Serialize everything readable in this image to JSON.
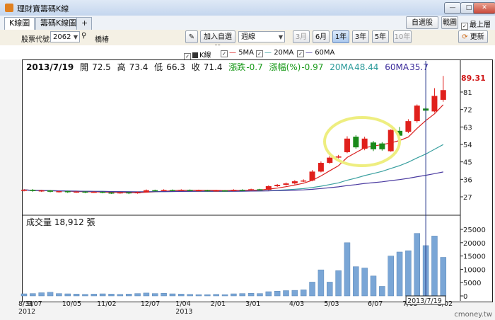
{
  "window": {
    "title": "理財寶籌碼K線",
    "toolbar_buttons": {
      "watchlist": "自選股",
      "print": "戰圖",
      "topmost": "最上層",
      "refresh": "更新"
    },
    "topmost_checked": true
  },
  "tabs": [
    {
      "label": "K線圖",
      "active": true
    },
    {
      "label": "籌碼K線圖",
      "active": false
    }
  ],
  "toolbar": {
    "stock_code_label": "股票代號:",
    "stock_code": "2062",
    "stock_name": "橋椿",
    "add_watchlist": "加入自選股",
    "period": "週線",
    "ranges": [
      {
        "label": "3月",
        "state": "disabled"
      },
      {
        "label": "6月",
        "state": "normal"
      },
      {
        "label": "1年",
        "state": "active"
      },
      {
        "label": "3年",
        "state": "normal"
      },
      {
        "label": "5年",
        "state": "normal"
      },
      {
        "label": "10年",
        "state": "disabled"
      }
    ]
  },
  "legend": [
    {
      "label": "K線",
      "color": "#222222"
    },
    {
      "label": "5MA",
      "color": "#d92020"
    },
    {
      "label": "20MA",
      "color": "#3aa0a0"
    },
    {
      "label": "60MA",
      "color": "#4a3aa0"
    }
  ],
  "info": {
    "date": "2013/7/19",
    "open_label": "開",
    "open": "72.5",
    "high_label": "高",
    "high": "73.4",
    "low_label": "低",
    "low": "66.3",
    "close_label": "收",
    "close": "71.4",
    "change_label": "漲跌",
    "change": "-0.7",
    "change_pct_label": "漲幅(%)",
    "change_pct": "-0.97",
    "ma20_label": "20MA",
    "ma20": "48.44",
    "ma60_label": "60MA",
    "ma60": "35.7"
  },
  "volume_label": "成交量 18,912 張",
  "crosshair_date": "2013/7/19",
  "watermark": "cmoney.tw",
  "chart_data": {
    "type": "candlestick",
    "max_marker": "89.31",
    "price_ticks": [
      81,
      72,
      63,
      54,
      45,
      36,
      27
    ],
    "volume_ticks": [
      25000,
      20000,
      15000,
      10000,
      5000,
      0
    ],
    "x_ticks": [
      {
        "label": "8/31",
        "sub": "2012",
        "i": 0
      },
      {
        "label": "9/07",
        "i": 1
      },
      {
        "label": "10/05",
        "i": 5
      },
      {
        "label": "11/02",
        "i": 9
      },
      {
        "label": "12/07",
        "i": 14
      },
      {
        "label": "1/04",
        "sub": "2013",
        "i": 18
      },
      {
        "label": "2/01",
        "i": 22
      },
      {
        "label": "3/01",
        "i": 26
      },
      {
        "label": "4/03",
        "i": 31
      },
      {
        "label": "5/03",
        "i": 35
      },
      {
        "label": "6/07",
        "i": 40
      },
      {
        "label": "7/05",
        "i": 44
      },
      {
        "label": "8/02",
        "i": 48
      }
    ],
    "candles": [
      {
        "o": 30.2,
        "c": 30.6,
        "h": 31.0,
        "l": 29.8,
        "v": 800
      },
      {
        "o": 30.6,
        "c": 30.0,
        "h": 31.0,
        "l": 29.6,
        "v": 900
      },
      {
        "o": 30.0,
        "c": 30.3,
        "h": 30.6,
        "l": 29.5,
        "v": 1200
      },
      {
        "o": 30.3,
        "c": 29.6,
        "h": 30.5,
        "l": 29.3,
        "v": 1400
      },
      {
        "o": 29.6,
        "c": 29.9,
        "h": 30.2,
        "l": 29.2,
        "v": 900
      },
      {
        "o": 29.9,
        "c": 29.4,
        "h": 30.1,
        "l": 29.0,
        "v": 800
      },
      {
        "o": 29.4,
        "c": 29.7,
        "h": 30.0,
        "l": 29.1,
        "v": 700
      },
      {
        "o": 29.7,
        "c": 29.3,
        "h": 29.9,
        "l": 28.9,
        "v": 600
      },
      {
        "o": 29.3,
        "c": 29.6,
        "h": 29.9,
        "l": 29.0,
        "v": 700
      },
      {
        "o": 29.6,
        "c": 29.2,
        "h": 29.8,
        "l": 28.8,
        "v": 800
      },
      {
        "o": 29.2,
        "c": 28.9,
        "h": 29.5,
        "l": 28.5,
        "v": 700
      },
      {
        "o": 28.9,
        "c": 29.3,
        "h": 29.6,
        "l": 28.6,
        "v": 600
      },
      {
        "o": 29.3,
        "c": 28.8,
        "h": 29.5,
        "l": 28.4,
        "v": 700
      },
      {
        "o": 28.8,
        "c": 29.4,
        "h": 29.7,
        "l": 28.6,
        "v": 900
      },
      {
        "o": 29.4,
        "c": 30.4,
        "h": 30.8,
        "l": 29.2,
        "v": 1100
      },
      {
        "o": 30.4,
        "c": 30.1,
        "h": 30.7,
        "l": 29.8,
        "v": 900
      },
      {
        "o": 30.1,
        "c": 30.5,
        "h": 30.9,
        "l": 29.9,
        "v": 1000
      },
      {
        "o": 30.5,
        "c": 30.3,
        "h": 30.8,
        "l": 30.0,
        "v": 800
      },
      {
        "o": 30.3,
        "c": 30.6,
        "h": 30.9,
        "l": 30.0,
        "v": 700
      },
      {
        "o": 30.6,
        "c": 30.2,
        "h": 30.8,
        "l": 29.9,
        "v": 600
      },
      {
        "o": 30.2,
        "c": 30.4,
        "h": 30.7,
        "l": 29.9,
        "v": 500
      },
      {
        "o": 30.4,
        "c": 30.1,
        "h": 30.6,
        "l": 29.8,
        "v": 500
      },
      {
        "o": 30.1,
        "c": 30.3,
        "h": 30.6,
        "l": 29.9,
        "v": 600
      },
      {
        "o": 30.3,
        "c": 30.0,
        "h": 30.5,
        "l": 29.8,
        "v": 500
      },
      {
        "o": 30.0,
        "c": 30.6,
        "h": 30.9,
        "l": 29.8,
        "v": 800
      },
      {
        "o": 30.6,
        "c": 30.3,
        "h": 30.9,
        "l": 30.0,
        "v": 900
      },
      {
        "o": 30.3,
        "c": 30.9,
        "h": 31.2,
        "l": 30.1,
        "v": 1000
      },
      {
        "o": 30.9,
        "c": 30.6,
        "h": 31.1,
        "l": 30.3,
        "v": 900
      },
      {
        "o": 30.6,
        "c": 32.5,
        "h": 32.9,
        "l": 30.4,
        "v": 1600
      },
      {
        "o": 32.5,
        "c": 33.2,
        "h": 33.6,
        "l": 32.1,
        "v": 1800
      },
      {
        "o": 33.2,
        "c": 33.9,
        "h": 34.4,
        "l": 32.8,
        "v": 2000
      },
      {
        "o": 33.9,
        "c": 35.0,
        "h": 35.6,
        "l": 33.4,
        "v": 2100
      },
      {
        "o": 35.0,
        "c": 35.4,
        "h": 36.0,
        "l": 34.6,
        "v": 2300
      },
      {
        "o": 35.4,
        "c": 40.0,
        "h": 40.8,
        "l": 35.0,
        "v": 5200
      },
      {
        "o": 40.0,
        "c": 44.5,
        "h": 45.2,
        "l": 39.6,
        "v": 9800
      },
      {
        "o": 44.5,
        "c": 47.2,
        "h": 48.0,
        "l": 44.0,
        "v": 5200
      },
      {
        "o": 47.2,
        "c": 47.8,
        "h": 48.6,
        "l": 46.8,
        "v": 9500
      },
      {
        "o": 50.0,
        "c": 57.0,
        "h": 58.2,
        "l": 49.5,
        "v": 20000
      },
      {
        "o": 58.0,
        "c": 52.5,
        "h": 58.8,
        "l": 51.8,
        "v": 11000
      },
      {
        "o": 51.8,
        "c": 57.0,
        "h": 58.0,
        "l": 51.0,
        "v": 10500
      },
      {
        "o": 55.0,
        "c": 51.5,
        "h": 55.8,
        "l": 50.6,
        "v": 7500
      },
      {
        "o": 54.5,
        "c": 51.5,
        "h": 55.2,
        "l": 50.8,
        "v": 3600
      },
      {
        "o": 50.5,
        "c": 61.5,
        "h": 61.8,
        "l": 50.2,
        "v": 15000
      },
      {
        "o": 61.0,
        "c": 58.5,
        "h": 63.0,
        "l": 57.8,
        "v": 16500
      },
      {
        "o": 60.5,
        "c": 66.0,
        "h": 67.0,
        "l": 59.8,
        "v": 17000
      },
      {
        "o": 66.0,
        "c": 74.0,
        "h": 74.6,
        "l": 65.2,
        "v": 23500
      },
      {
        "o": 72.5,
        "c": 71.4,
        "h": 73.4,
        "l": 66.3,
        "v": 18912
      },
      {
        "o": 71.0,
        "c": 79.0,
        "h": 83.0,
        "l": 70.5,
        "v": 22500
      },
      {
        "o": 77.0,
        "c": 82.0,
        "h": 89.3,
        "l": 76.0,
        "v": 14500
      }
    ]
  }
}
